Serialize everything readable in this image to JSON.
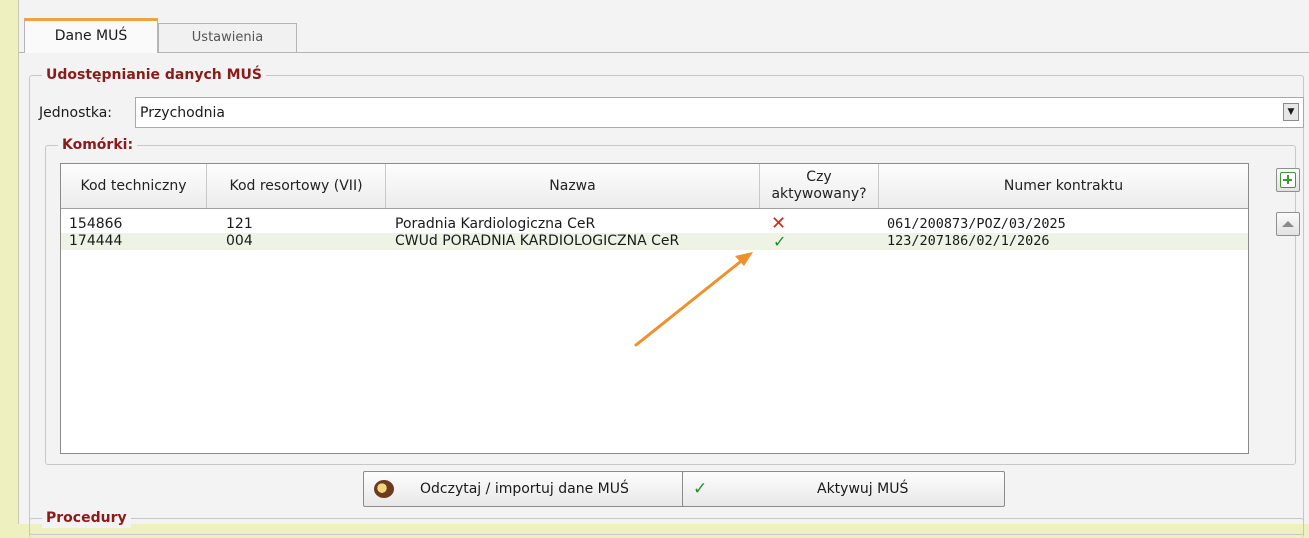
{
  "tabs": [
    {
      "label": "Dane MUŚ",
      "active": true
    },
    {
      "label": "Ustawienia",
      "active": false
    }
  ],
  "sharing_group": {
    "title": "Udostępnianie danych MUŚ"
  },
  "unit": {
    "label": "Jednostka:",
    "value": "Przychodnia"
  },
  "cells_group": {
    "title": "Komórki:"
  },
  "grid": {
    "columns": [
      "Kod techniczny",
      "Kod resortowy (VII)",
      "Nazwa",
      "Czy aktywowany?",
      "Numer kontraktu"
    ],
    "rows": [
      {
        "tech_code": "154866",
        "dept_code": "121",
        "name": "Poradnia Kardiologiczna CeR",
        "active_icon": "cross-icon",
        "active_glyph": "✕",
        "contract": "061/200873/POZ/03/2025"
      },
      {
        "tech_code": "174444",
        "dept_code": "004",
        "name": "CWUd PORADNIA KARDIOLOGICZNA CeR",
        "active_icon": "check-icon",
        "active_glyph": "✓",
        "contract": "123/207186/02/1/2026"
      }
    ]
  },
  "buttons": {
    "read_import": "Odczytaj / importuj dane MUŚ",
    "activate": "Aktywuj MUŚ"
  },
  "procedures_group": {
    "title": "Procedury"
  },
  "colors": {
    "accent_tab": "#f2a23c",
    "group_title": "#8b1a1a",
    "status_active": "#1f8f28",
    "status_inactive": "#d8261d",
    "annotation_arrow": "#f0902a"
  }
}
